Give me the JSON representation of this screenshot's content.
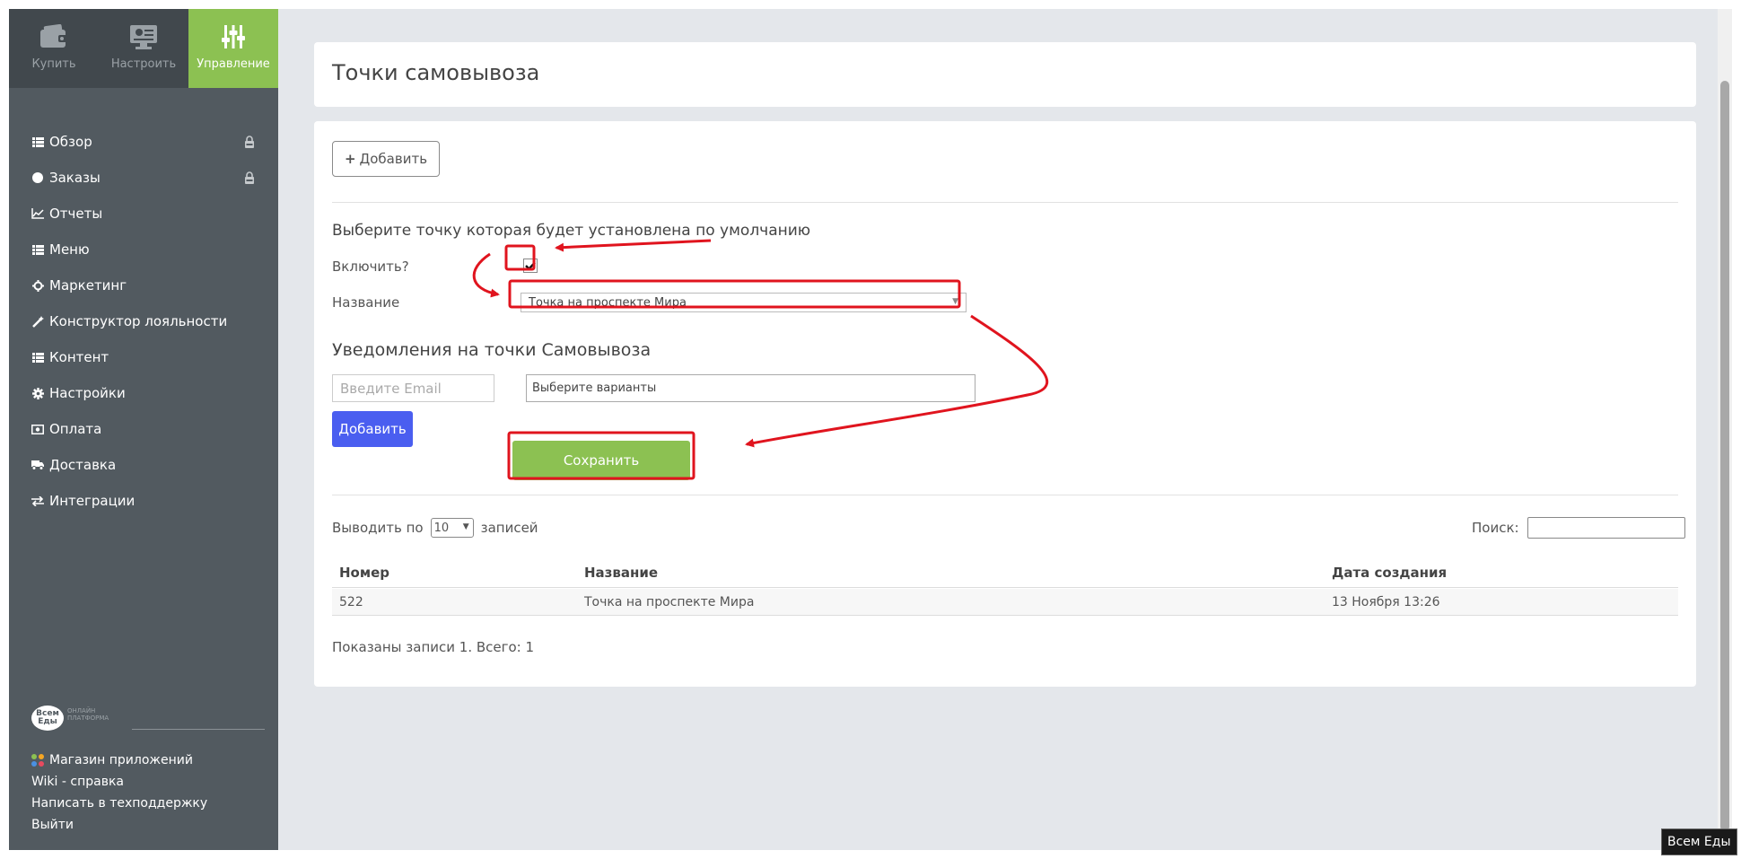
{
  "topnav": {
    "buy_label": "Купить",
    "setup_label": "Настроить",
    "manage_label": "Управление"
  },
  "sidebar": {
    "items": [
      {
        "label": "Обзор"
      },
      {
        "label": "Заказы"
      },
      {
        "label": "Отчеты"
      },
      {
        "label": "Меню"
      },
      {
        "label": "Маркетинг"
      },
      {
        "label": "Конструктор лояльности"
      },
      {
        "label": "Контент"
      },
      {
        "label": "Настройки"
      },
      {
        "label": "Оплата"
      },
      {
        "label": "Доставка"
      },
      {
        "label": "Интеграции"
      }
    ],
    "brand": {
      "logo_text": "Всем Еды",
      "tagline_1": "ОНЛАЙН",
      "tagline_2": "ПЛАТФОРМА"
    },
    "footer": {
      "apps": "Магазин приложений",
      "wiki": "Wiki - справка",
      "support": "Написать в техподдержку",
      "logout": "Выйти"
    }
  },
  "page": {
    "title": "Точки самовывоза",
    "add_button": "Добавить",
    "default_title": "Выберите точку которая будет установлена по умолчанию",
    "enable_label": "Включить?",
    "name_label": "Название",
    "selected_point": "Точка на проспекте Мира",
    "notifications_title": "Уведомления на точки Самовывоза",
    "email_placeholder": "Введите Email",
    "variants_placeholder": "Выберите варианты",
    "add_blue_button": "Добавить",
    "save_button": "Сохранить"
  },
  "table": {
    "show_label": "Выводить по",
    "page_size": "10",
    "records_label": "записей",
    "search_label": "Поиск:",
    "columns": [
      "Номер",
      "Название",
      "Дата создания"
    ],
    "rows": [
      [
        "522",
        "Точка на проспекте Мира",
        "13 Ноября 13:26"
      ]
    ],
    "info": "Показаны записи 1. Всего: 1"
  },
  "tooltip": "Всем Еды",
  "colors": {
    "accent_green": "#8cc152",
    "sidebar": "#525a60",
    "topnav": "#41484d",
    "primary_blue": "#4a5ef0",
    "annotation_red": "#e0141e"
  }
}
